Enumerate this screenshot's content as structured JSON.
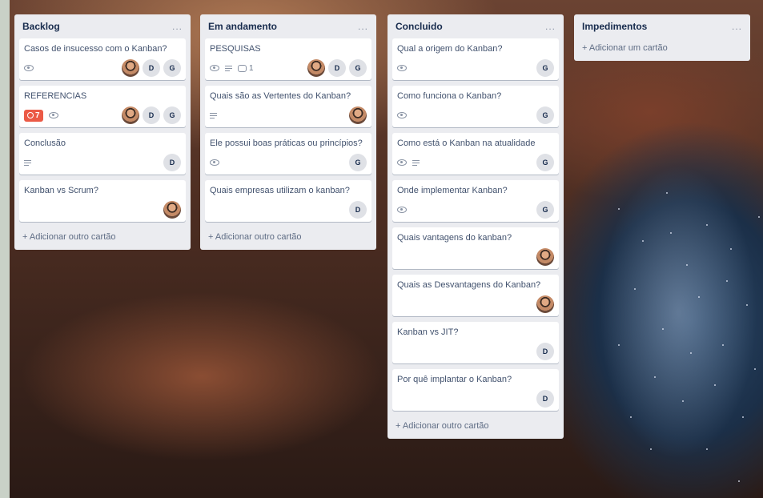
{
  "board": {
    "lists": [
      {
        "title": "Backlog",
        "menu": "...",
        "add_label": "+ Adicionar outro cartão",
        "cards": [
          {
            "title": "Casos de insucesso com o Kanban?",
            "badges": [
              "eye"
            ],
            "due": "",
            "comments": "",
            "members": [
              "photo",
              "D",
              "G"
            ]
          },
          {
            "title": "REFERENCIAS",
            "badges": [
              "due",
              "eye"
            ],
            "due": "7",
            "comments": "",
            "members": [
              "photo",
              "D",
              "G"
            ]
          },
          {
            "title": "Conclusão",
            "badges": [
              "desc"
            ],
            "due": "",
            "comments": "",
            "members": [
              "D"
            ]
          },
          {
            "title": "Kanban vs Scrum?",
            "badges": [],
            "due": "",
            "comments": "",
            "members": [
              "photo"
            ]
          }
        ]
      },
      {
        "title": "Em andamento",
        "menu": "...",
        "add_label": "+ Adicionar outro cartão",
        "cards": [
          {
            "title": "PESQUISAS",
            "badges": [
              "eye",
              "desc",
              "comment"
            ],
            "due": "",
            "comments": "1",
            "members": [
              "photo",
              "D",
              "G"
            ]
          },
          {
            "title": "Quais são as Vertentes do Kanban?",
            "badges": [
              "desc"
            ],
            "due": "",
            "comments": "",
            "members": [
              "photo"
            ]
          },
          {
            "title": "Ele possui boas práticas ou princípios?",
            "badges": [
              "eye"
            ],
            "due": "",
            "comments": "",
            "members": [
              "G"
            ]
          },
          {
            "title": "Quais empresas utilizam o kanban?",
            "badges": [],
            "due": "",
            "comments": "",
            "members": [
              "D"
            ]
          }
        ]
      },
      {
        "title": "Concluido",
        "menu": "...",
        "add_label": "+ Adicionar outro cartão",
        "cards": [
          {
            "title": "Qual a origem do Kanban?",
            "badges": [
              "eye"
            ],
            "due": "",
            "comments": "",
            "members": [
              "G"
            ]
          },
          {
            "title": "Como funciona o Kanban?",
            "badges": [
              "eye"
            ],
            "due": "",
            "comments": "",
            "members": [
              "G"
            ]
          },
          {
            "title": "Como está o Kanban na atualidade",
            "badges": [
              "eye",
              "desc"
            ],
            "due": "",
            "comments": "",
            "members": [
              "G"
            ]
          },
          {
            "title": "Onde implementar Kanban?",
            "badges": [
              "eye"
            ],
            "due": "",
            "comments": "",
            "members": [
              "G"
            ]
          },
          {
            "title": "Quais vantagens do kanban?",
            "badges": [],
            "due": "",
            "comments": "",
            "members": [
              "photo"
            ]
          },
          {
            "title": "Quais as Desvantagens do Kanban?",
            "badges": [],
            "due": "",
            "comments": "",
            "members": [
              "photo"
            ]
          },
          {
            "title": "Kanban vs JIT?",
            "badges": [],
            "due": "",
            "comments": "",
            "members": [
              "D"
            ]
          },
          {
            "title": "Por quê implantar o Kanban?",
            "badges": [],
            "due": "",
            "comments": "",
            "members": [
              "D"
            ]
          }
        ]
      },
      {
        "title": "Impedimentos",
        "menu": "...",
        "add_label": "+ Adicionar um cartão",
        "cards": []
      }
    ]
  },
  "colors": {
    "list_bg": "#ebecf0",
    "due_badge": "#eb5a46",
    "text": "#172b4d"
  }
}
